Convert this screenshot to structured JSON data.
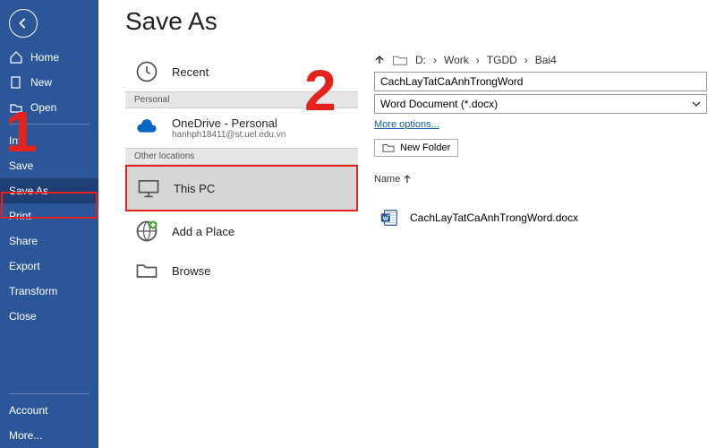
{
  "title": "Save As",
  "sidebar": {
    "items": [
      {
        "label": "Home"
      },
      {
        "label": "New"
      },
      {
        "label": "Open"
      },
      {
        "label": "Info"
      },
      {
        "label": "Save"
      },
      {
        "label": "Save As"
      },
      {
        "label": "Print"
      },
      {
        "label": "Share"
      },
      {
        "label": "Export"
      },
      {
        "label": "Transform"
      },
      {
        "label": "Close"
      },
      {
        "label": "Account"
      },
      {
        "label": "More..."
      }
    ]
  },
  "locations": {
    "recent": "Recent",
    "section_personal": "Personal",
    "onedrive": {
      "title": "OneDrive - Personal",
      "sub": "hanhph18411@st.uel.edu.vn"
    },
    "section_other": "Other locations",
    "thispc": "This PC",
    "addplace": "Add a Place",
    "browse": "Browse"
  },
  "breadcrumb": {
    "drive": "D:",
    "parts": [
      "Work",
      "TGDD",
      "Bai4"
    ]
  },
  "filename": "CachLayTatCaAnhTrongWord",
  "filetype": "Word Document (*.docx)",
  "more_options": "More options...",
  "new_folder": "New Folder",
  "list_header": "Name",
  "file": "CachLayTatCaAnhTrongWord.docx",
  "annotations": {
    "one": "1",
    "two": "2"
  }
}
